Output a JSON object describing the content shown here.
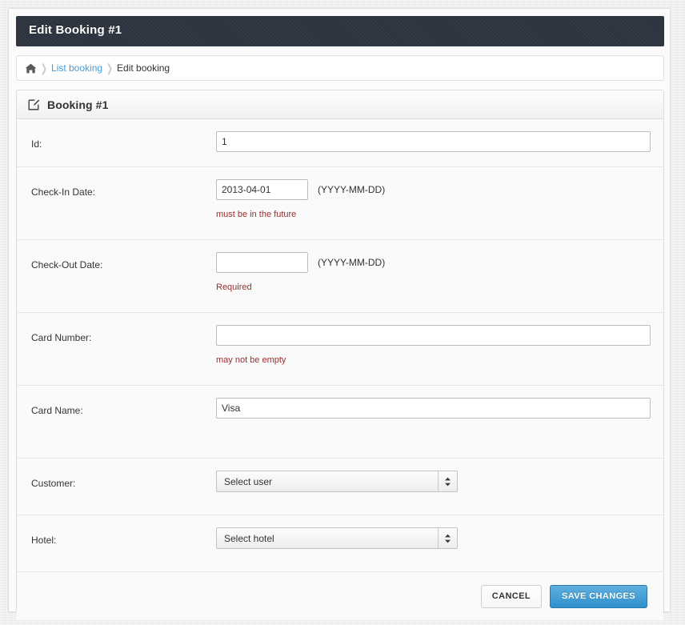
{
  "titlebar": {
    "title": "Edit Booking #1"
  },
  "breadcrumb": {
    "home_icon": "home-icon",
    "separator": "❯",
    "items": [
      {
        "label": "List booking",
        "current": false
      },
      {
        "label": "Edit booking",
        "current": true
      }
    ]
  },
  "panel": {
    "icon": "edit-square-icon",
    "title": "Booking #1",
    "rows": [
      {
        "label": "Id:",
        "type": "text",
        "value": "1",
        "placeholder": "",
        "hint": "",
        "error": ""
      },
      {
        "label": "Check-In Date:",
        "type": "date-text",
        "value": "2013-04-01",
        "placeholder": "",
        "hint": "(YYYY-MM-DD)",
        "error": "must be in the future"
      },
      {
        "label": "Check-Out Date:",
        "type": "date-text",
        "value": "",
        "placeholder": "",
        "hint": "(YYYY-MM-DD)",
        "error": "Required"
      },
      {
        "label": "Card Number:",
        "type": "text",
        "value": "",
        "placeholder": "",
        "hint": "",
        "error": "may not be empty"
      },
      {
        "label": "Card Name:",
        "type": "text",
        "value": "Visa",
        "placeholder": "",
        "hint": "",
        "error": ""
      },
      {
        "label": "Customer:",
        "type": "select",
        "value": "Select user",
        "placeholder": "",
        "hint": "",
        "error": ""
      },
      {
        "label": "Hotel:",
        "type": "select",
        "value": "Select hotel",
        "placeholder": "",
        "hint": "",
        "error": ""
      }
    ]
  },
  "footer": {
    "cancel_label": "Cancel",
    "save_label": "Save Changes"
  },
  "colors": {
    "titlebar_bg": "#2f3641",
    "accent_blue": "#2f8fca",
    "link_blue": "#4a9bd4",
    "error_red": "#9b2d2d",
    "page_bg": "#eceaea"
  }
}
